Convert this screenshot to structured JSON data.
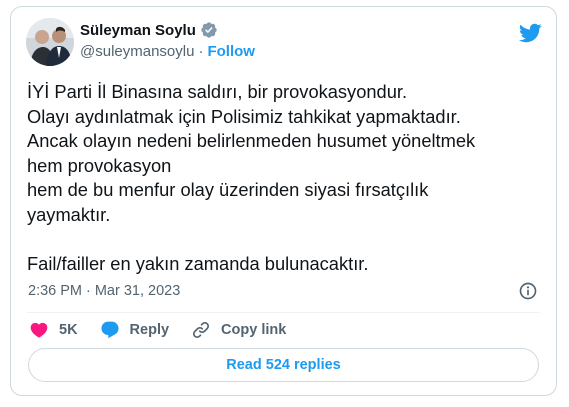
{
  "author": {
    "name": "Süleyman Soylu",
    "handle": "@suleymansoylu",
    "separator": "·",
    "follow_label": "Follow"
  },
  "icons": {
    "verified": "verified-badge-icon",
    "logo": "twitter-bird-icon",
    "info": "info-icon",
    "like": "heart-icon",
    "reply": "reply-bubble-icon",
    "copy": "link-icon"
  },
  "tweet": {
    "lines": [
      "İYİ Parti İl Binasına saldırı, bir provokasyondur.",
      "Olayı aydınlatmak için Polisimiz tahkikat yapmaktadır.",
      "Ancak olayın nedeni belirlenmeden husumet yöneltmek",
      "hem provokasyon",
      "hem de bu menfur olay üzerinden siyasi fırsatçılık",
      "yaymaktır.",
      "",
      "Fail/failler en yakın zamanda bulunacaktır."
    ]
  },
  "meta": {
    "time": "2:36 PM",
    "separator": "·",
    "date": "Mar 31, 2023"
  },
  "actions": {
    "likes": "5K",
    "reply_label": "Reply",
    "copy_label": "Copy link"
  },
  "footer": {
    "read_replies": "Read 524 replies"
  },
  "colors": {
    "accent": "#1d9bf0",
    "like": "#f91880",
    "muted": "#536471",
    "text": "#0f1419",
    "border": "#cfd9de"
  }
}
